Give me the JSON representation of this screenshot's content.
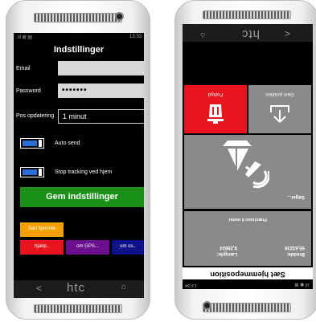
{
  "left_screen": {
    "status_time": "13:33",
    "title": "Indstillinger",
    "email_label": "Email",
    "email_value": "",
    "password_label": "Password",
    "password_value": "•••••••",
    "pos_label": "Pos opdatering",
    "pos_value": "1 minut",
    "toggle1_label": "Auto send",
    "toggle2_label": "Stop tracking ved hjem",
    "save_label": "Gem indstillinger",
    "set_home_label": "Sæt hjemme",
    "help_label": "hjælp..",
    "gps_label": "om GPS...",
    "about_label": "om os..",
    "brand": "htc"
  },
  "right_screen": {
    "status_time": "13:34",
    "title": "Sæt hjemmeposition",
    "lat_label": "Bredde:",
    "lat_value": "55,63236",
    "lon_label": "Længde:",
    "lon_value": "9,29924",
    "precision": "Præcision 6 meter",
    "searching": "Søger...",
    "save_pos_label": "Gem position",
    "discard_label": "Forkyd",
    "brand": "htc"
  },
  "colors": {
    "green": "#1a8f1a",
    "orange": "#f5a000",
    "red": "#e8141e",
    "purple": "#6a0f8e",
    "navy": "#11118a",
    "tile_gray": "#8a8a8a"
  }
}
